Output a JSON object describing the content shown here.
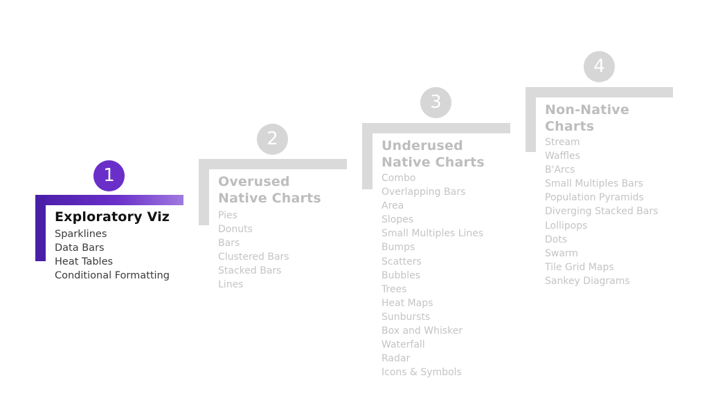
{
  "colors": {
    "active_accent": "#6a2fc9",
    "active_bar_dark": "#4a1fa8",
    "inactive_gray": "#d6d6d6",
    "inactive_text": "#c4c4c4"
  },
  "steps": [
    {
      "number": "1",
      "title": "Exploratory Viz",
      "state": "active",
      "items": [
        "Sparklines",
        "Data Bars",
        "Heat Tables",
        "Conditional Formatting"
      ]
    },
    {
      "number": "2",
      "title_lines": [
        "Overused",
        "Native Charts"
      ],
      "state": "inactive",
      "items": [
        "Pies",
        "Donuts",
        "Bars",
        "Clustered Bars",
        "Stacked Bars",
        "Lines"
      ]
    },
    {
      "number": "3",
      "title_lines": [
        "Underused",
        "Native Charts"
      ],
      "state": "inactive",
      "items": [
        "Combo",
        "Overlapping Bars",
        "Area",
        "Slopes",
        "Small Multiples Lines",
        "Bumps",
        "Scatters",
        "Bubbles",
        "Trees",
        "Heat Maps",
        "Sunbursts",
        "Box and Whisker",
        "Waterfall",
        "Radar",
        "Icons & Symbols"
      ]
    },
    {
      "number": "4",
      "title_lines": [
        "Non-Native",
        "Charts"
      ],
      "state": "inactive",
      "items": [
        "Stream",
        "Waffles",
        "B'Arcs",
        "Small Multiples Bars",
        "Population Pyramids",
        "Diverging Stacked Bars",
        "Lollipops",
        "Dots",
        "Swarm",
        "Tile Grid Maps",
        "Sankey Diagrams"
      ]
    }
  ]
}
